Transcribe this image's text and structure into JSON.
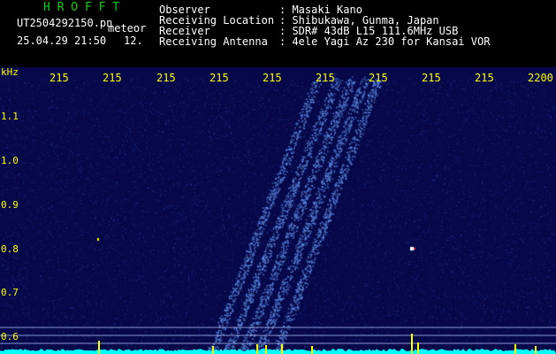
{
  "header": {
    "title": "H R O F F T",
    "filename": "UT2504292150.pn",
    "tag": "meteor",
    "datetime": "25.04.29 21:50",
    "count": "12.",
    "observer_label": "Observer",
    "observer_value": ": Masaki Kano",
    "location_label": "Receiving Location",
    "location_value": ": Shibukawa, Gunma, Japan",
    "receiver_label": "Receiver",
    "receiver_value": ": SDR# 43dB L15 111.6MHz USB",
    "antenna_label": "Receiving Antenna",
    "antenna_value": ": 4ele Yagi Az 230 for Kansai VOR"
  },
  "axis": {
    "unit": "kHz",
    "x_ticks": [
      "215",
      "215",
      "215",
      "215",
      "215",
      "215",
      "215",
      "215",
      "215",
      "2200"
    ],
    "y_ticks": [
      "1.1",
      "1.0",
      "0.9",
      "0.8",
      "0.7",
      "0.6"
    ]
  },
  "colors": {
    "background": "#06084a",
    "label": "#ffff00",
    "title": "#00d400",
    "noise": "#3a4cff",
    "trace": "#6f9dff",
    "baseline": "#00ffff"
  }
}
